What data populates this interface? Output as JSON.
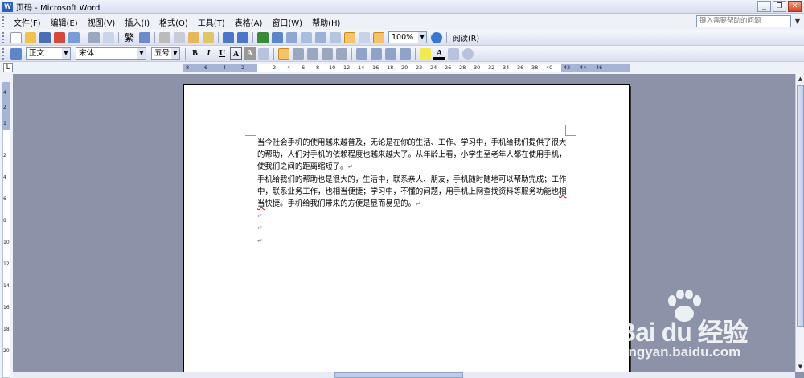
{
  "window": {
    "title": "页码 - Microsoft Word",
    "app_icon": "W"
  },
  "menu": {
    "items": [
      "文件(F)",
      "编辑(E)",
      "视图(V)",
      "插入(I)",
      "格式(O)",
      "工具(T)",
      "表格(A)",
      "窗口(W)",
      "帮助(H)"
    ],
    "help_placeholder": "键入需要帮助的问题"
  },
  "toolbar_standard": {
    "zoom": "100%",
    "read_label": "阅读(R)",
    "traditional_label": "繁"
  },
  "toolbar_format": {
    "style": "正文",
    "font": "宋体",
    "size": "五号",
    "bold": "B",
    "italic": "I",
    "underline": "U",
    "char_a": "A"
  },
  "ruler": {
    "left": [
      "8",
      "6",
      "4",
      "2"
    ],
    "right": [
      "2",
      "4",
      "6",
      "8",
      "10",
      "12",
      "14",
      "16",
      "18",
      "20",
      "22",
      "24",
      "26",
      "28",
      "30",
      "32",
      "34",
      "36",
      "38",
      "40",
      "42",
      "44",
      "46"
    ]
  },
  "vruler": [
    "4",
    "2",
    "1",
    "2",
    "4",
    "6",
    "8",
    "10",
    "12",
    "14",
    "16",
    "18",
    "20"
  ],
  "document": {
    "para1_a": "当今社会手机的使用越来越普及，无论是在你的生活、工作、学习中，手机给我们提供了很大的帮助，人们对手机的依赖程度也越来越大了。从年龄上看，小学生至老年人都在使用手机，使我们之间的距离缩短了。",
    "para2_a": "手机给我们的帮助也是很大的，生活中，联系亲人、朋友，手机随时随地可以帮助完成；工作中，联系业务工作，也相当便捷；学习中，不懂的问题，用手机上网查找资料等服务功能也",
    "para2_wavy": "相当",
    "para2_b": "快捷。手机给我们带来的方便是显而易见的。",
    "para_mark": "↵"
  },
  "watermark": {
    "logo": "Bai du 经验",
    "url": "jingyan.baidu.com"
  }
}
